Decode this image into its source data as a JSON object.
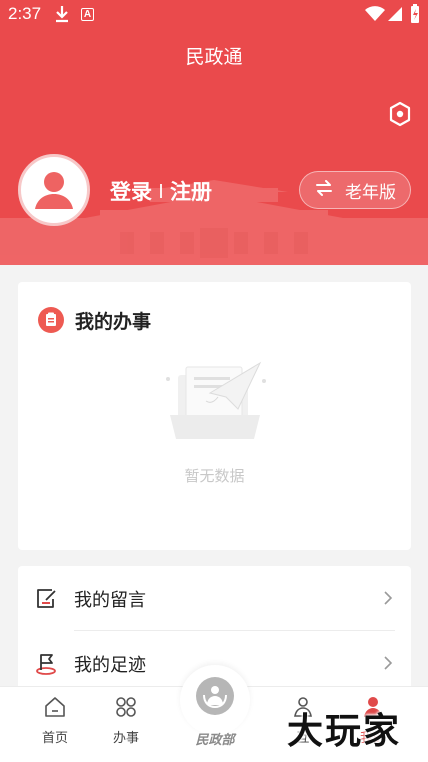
{
  "status_bar": {
    "time": "2:37",
    "badge_letter": "A"
  },
  "header": {
    "title": "民政通",
    "login_label": "登录",
    "register_label": "注册",
    "elder_mode_label": "老年版"
  },
  "my_affairs": {
    "title": "我的办事",
    "empty_text": "暂无数据"
  },
  "list": [
    {
      "label": "我的留言",
      "icon": "message-edit-icon"
    },
    {
      "label": "我的足迹",
      "icon": "footprint-flag-icon"
    }
  ],
  "bottom_nav": {
    "home": "首页",
    "services": "办事",
    "center": "民政部",
    "interact": "互",
    "mine": "我的"
  },
  "watermark": "大玩家",
  "colors": {
    "brand_red": "#ea4a4c",
    "card_bg": "#ffffff",
    "page_bg": "#f3f3f3"
  }
}
